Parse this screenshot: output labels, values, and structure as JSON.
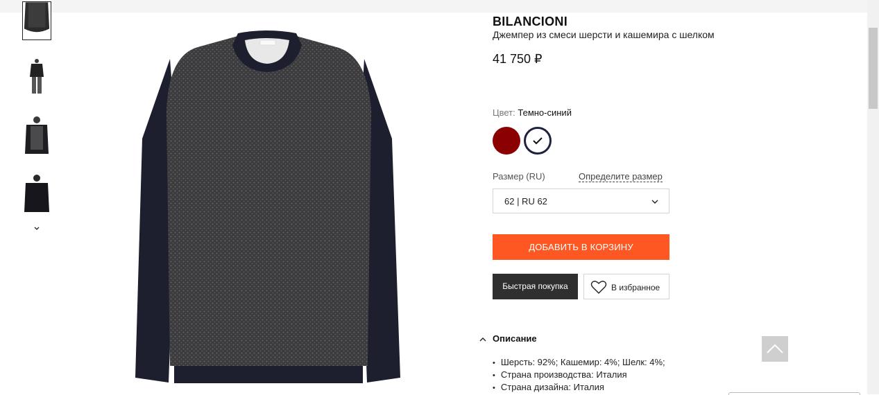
{
  "product": {
    "brand": "BILANCIONI",
    "name": "Джемпер из смеси шерсти и кашемира с шелком",
    "price": "41 750 ₽"
  },
  "color": {
    "label": "Цвет:",
    "value": "Темно-синий",
    "swatches": [
      {
        "name": "red",
        "hex": "#8b0000",
        "selected": false
      },
      {
        "name": "navy",
        "hex": "#1f2140",
        "selected": true
      }
    ]
  },
  "size": {
    "label": "Размер (RU)",
    "guide_link": "Определите размер",
    "selected": "62 | RU 62"
  },
  "actions": {
    "add_to_cart": "ДОБАВИТЬ В КОРЗИНУ",
    "quick_buy": "Быстрая покупка",
    "favorites": "В избранное"
  },
  "description": {
    "title": "Описание",
    "items": [
      "Шерсть: 92%; Кашемир: 4%; Шелк: 4%;",
      "Страна производства: Италия",
      "Страна дизайна: Италия"
    ]
  },
  "colors": {
    "accent": "#ff5722",
    "dark_button": "#2f2f2f"
  }
}
